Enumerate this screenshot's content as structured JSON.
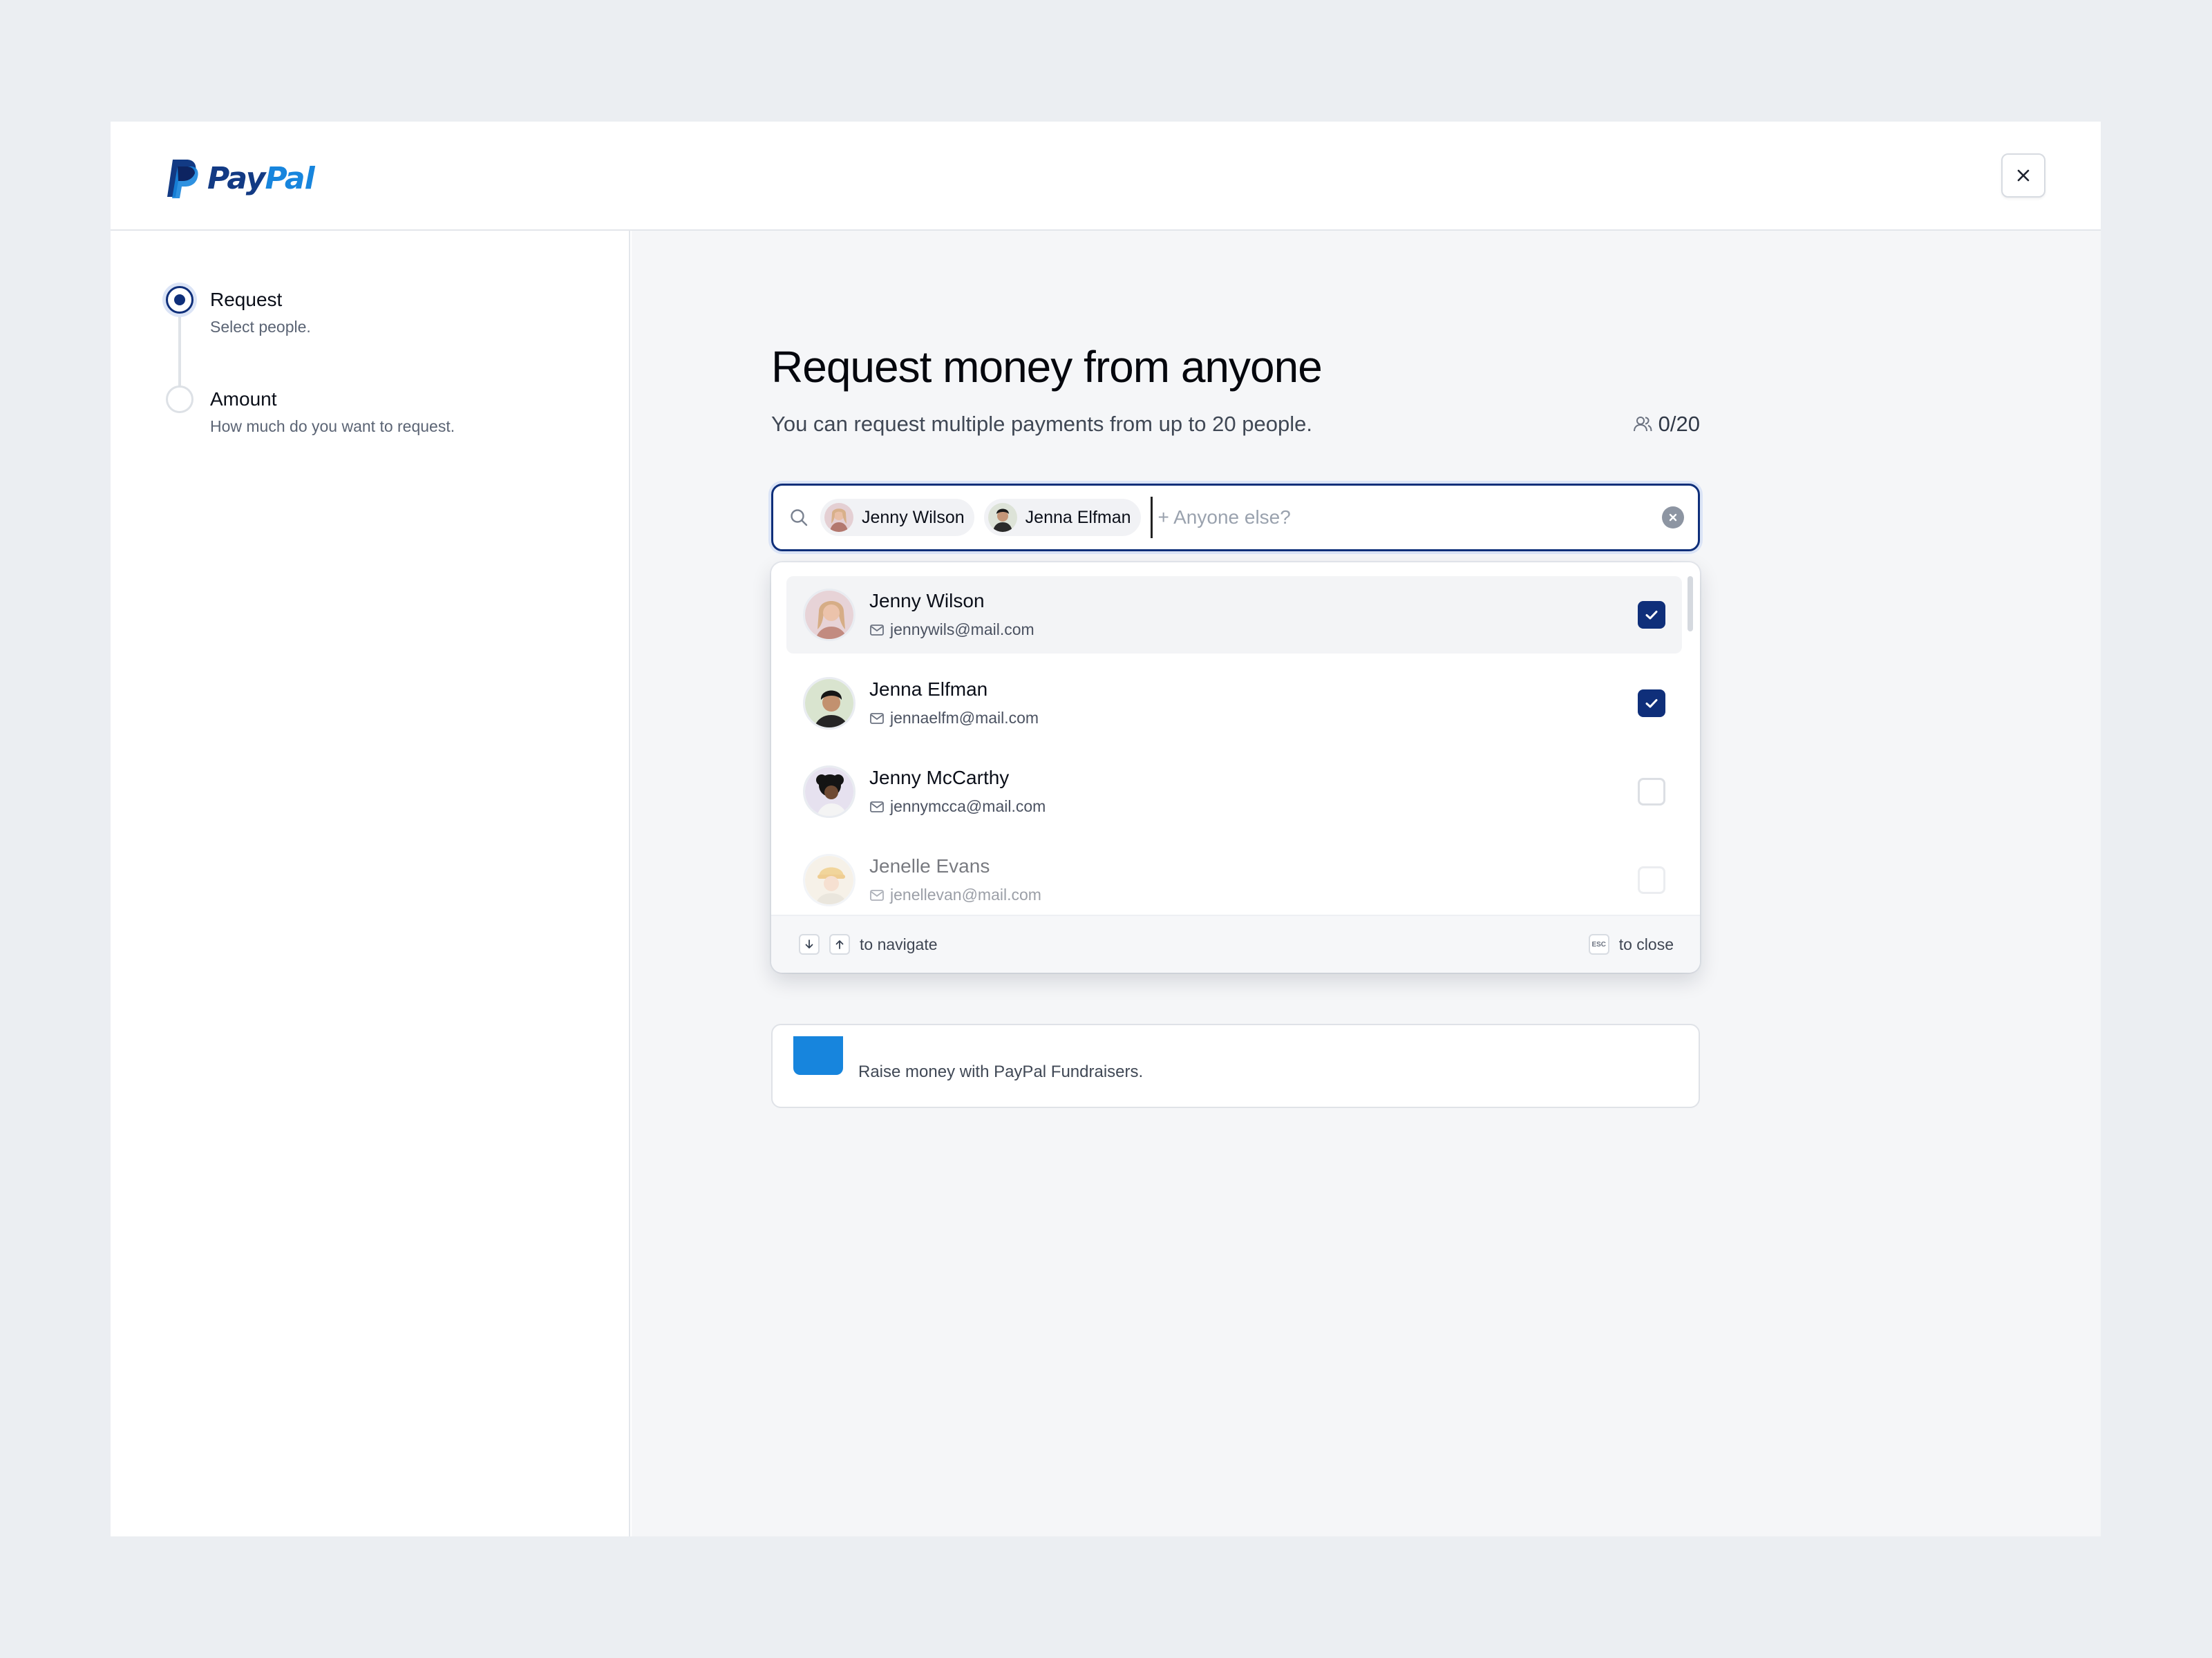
{
  "brand": {
    "logo_pay": "Pay",
    "logo_pal": "Pal"
  },
  "header": {
    "close_icon": "close-icon"
  },
  "steps": [
    {
      "title": "Request",
      "subtitle": "Select people.",
      "state": "active"
    },
    {
      "title": "Amount",
      "subtitle": "How much do you want to request.",
      "state": "idle"
    }
  ],
  "main": {
    "title": "Request money from anyone",
    "subtitle": "You can request multiple payments from up to 20 people.",
    "counter": "0/20"
  },
  "search": {
    "chips": [
      {
        "label": "Jenny Wilson"
      },
      {
        "label": "Jenna Elfman"
      }
    ],
    "placeholder": "+ Anyone else?"
  },
  "contacts": [
    {
      "name": "Jenny Wilson",
      "email": "jennywils@mail.com",
      "checked": true
    },
    {
      "name": "Jenna Elfman",
      "email": "jennaelfm@mail.com",
      "checked": true
    },
    {
      "name": "Jenny McCarthy",
      "email": "jennymcca@mail.com",
      "checked": false
    },
    {
      "name": "Jenelle Evans",
      "email": "jenellevan@mail.com",
      "checked": false
    }
  ],
  "dropdown_footer": {
    "navigate": "to navigate",
    "close": "to close",
    "esc_key": "ESC"
  },
  "fundraiser": {
    "text": "Raise money with PayPal Fundraisers."
  },
  "colors": {
    "primary": "#0f2f7a",
    "brand_dark": "#123a84",
    "brand_light": "#1785dd",
    "page_bg": "#ebeef2"
  }
}
